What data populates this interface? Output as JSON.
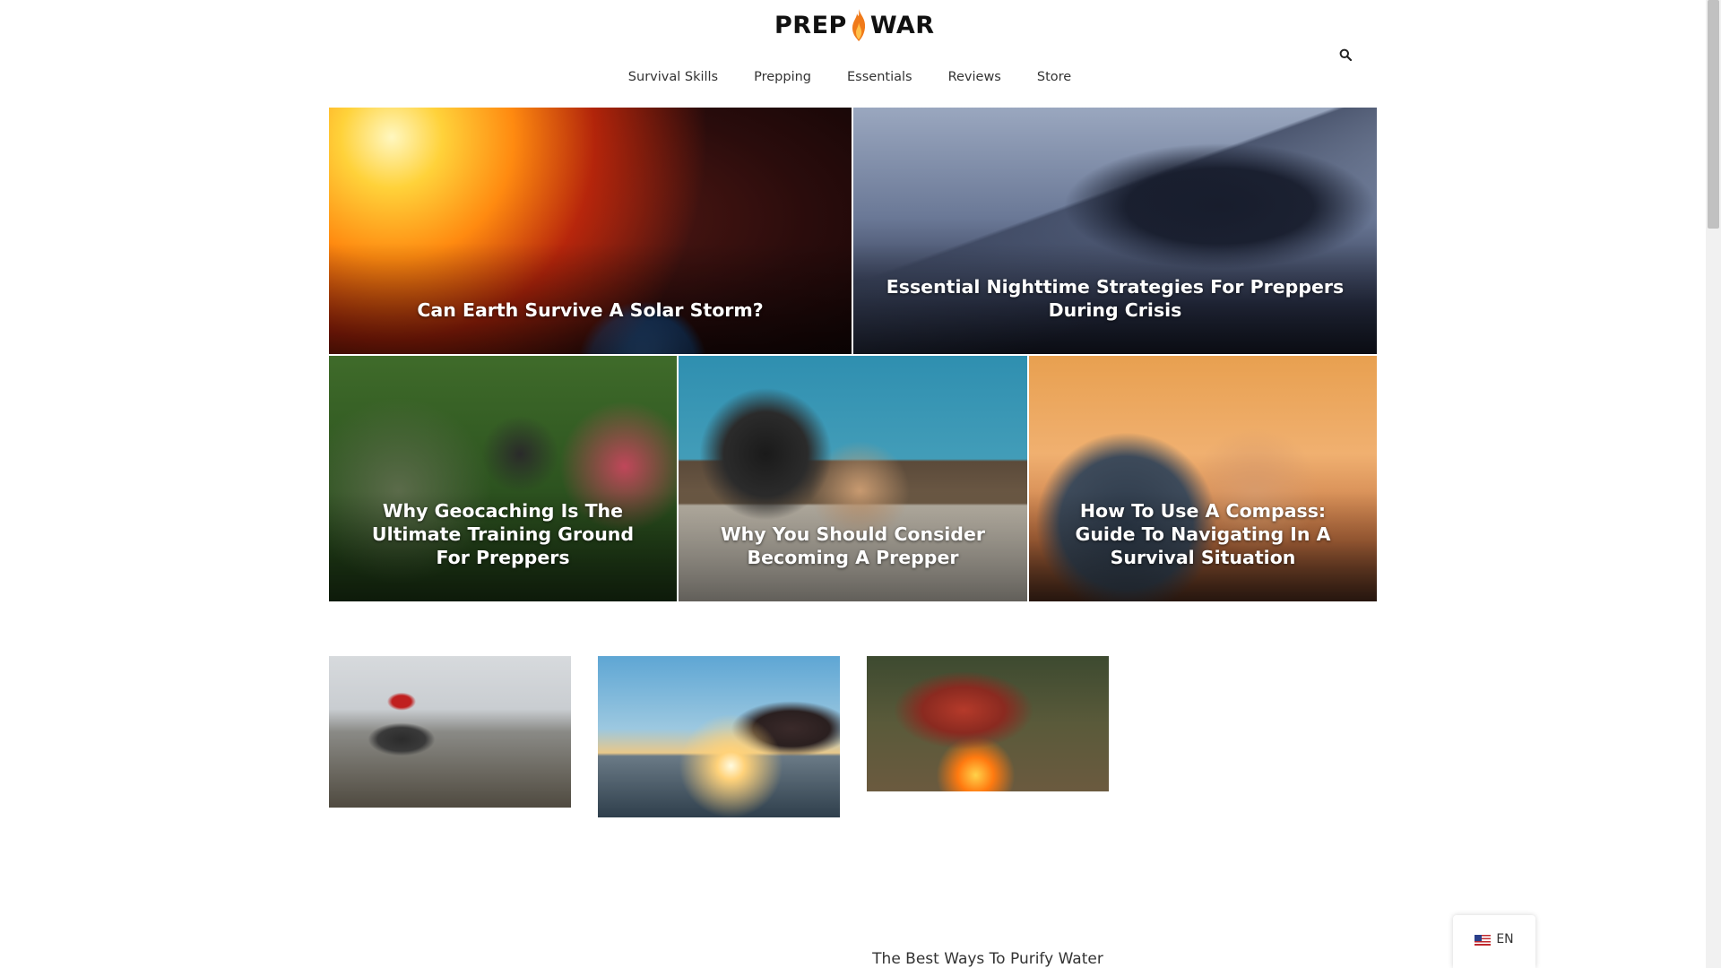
{
  "header": {
    "logo_left": "PREP",
    "logo_right": "WAR",
    "search_icon": "search-icon"
  },
  "nav": {
    "items": [
      {
        "label": "Survival Skills"
      },
      {
        "label": "Prepping"
      },
      {
        "label": "Essentials"
      },
      {
        "label": "Reviews"
      },
      {
        "label": "Store"
      }
    ]
  },
  "featured": [
    {
      "title": "Can Earth Survive A Solar Storm?"
    },
    {
      "title": "Essential Nighttime Strategies For Preppers During Crisis"
    },
    {
      "title": "Why Geocaching Is The Ultimate Training Ground For Preppers"
    },
    {
      "title": "Why You Should Consider Becoming A Prepper"
    },
    {
      "title": "How To Use A Compass: Guide To Navigating In A Survival Situation"
    }
  ],
  "thumbs": {
    "caption_3": "The Best Ways To Purify Water"
  },
  "language": {
    "label": "EN",
    "flag_icon": "us-flag-icon"
  },
  "colors": {
    "brand_flame": "#f07a1a",
    "text": "#333333",
    "background": "#ffffff"
  }
}
